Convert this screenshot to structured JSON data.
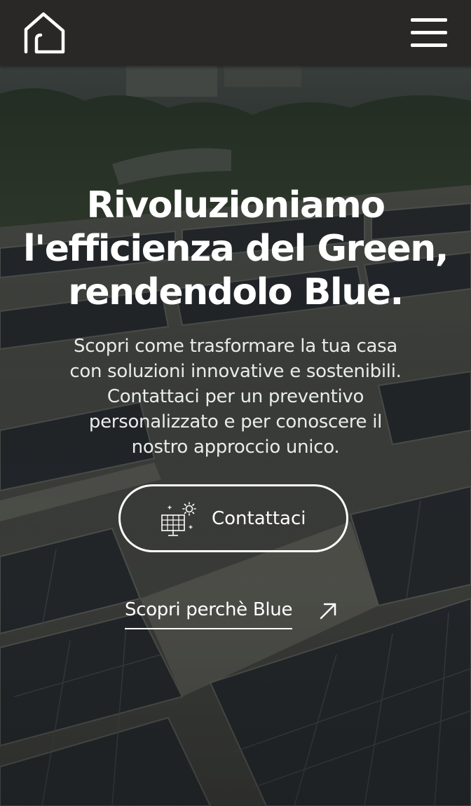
{
  "header": {
    "logo_icon": "house-outline-icon",
    "menu_icon": "hamburger-menu-icon",
    "background": "#292826"
  },
  "hero": {
    "title_line1": "Rivoluzioniamo",
    "title_line2": "l'efficienza del Green,",
    "title_line3": "rendendolo Blue.",
    "subtitle_line1": "Scopri come trasformare la tua casa",
    "subtitle_line2": "con soluzioni innovative e sostenibili.",
    "subtitle_line3": "Contattaci per un preventivo",
    "subtitle_line4": "personalizzato e per conoscere il",
    "subtitle_line5": "nostro approccio unico.",
    "cta_label": "Contattaci",
    "cta_icon": "solar-panel-sun-icon",
    "secondary_link_label": "Scopri perchè Blue",
    "secondary_link_icon": "arrow-up-right-icon",
    "background_image": "solar-panels-rooftop-photo"
  },
  "colors": {
    "text": "#ffffff",
    "header_bg": "#292826"
  }
}
